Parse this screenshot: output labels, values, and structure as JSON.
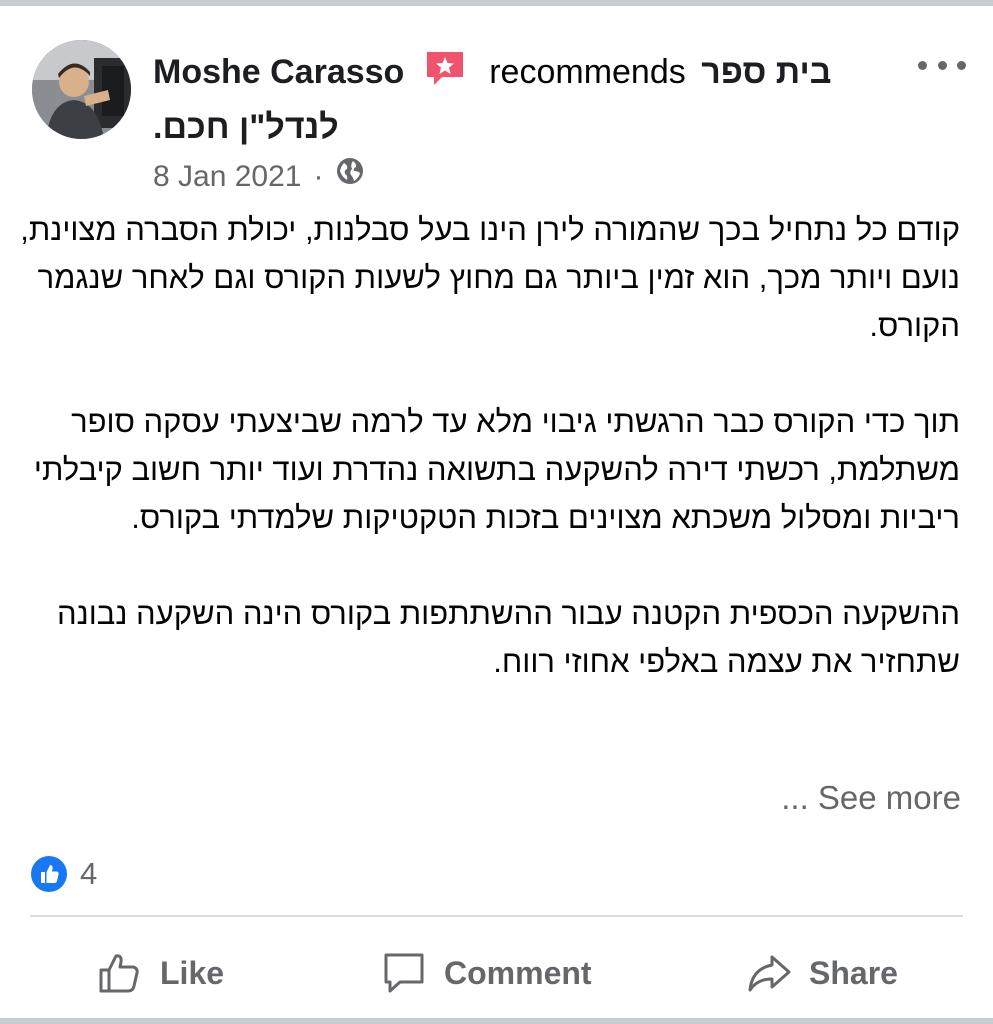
{
  "post": {
    "author": "Moshe Carasso",
    "verb": "recommends",
    "page_name_part1": "בית ספר",
    "page_name_part2": "לנדל\"ן חכם.",
    "date": "8 Jan 2021",
    "separator": "·",
    "privacy_icon": "globe-icon",
    "badge_icon": "recommendation-star-icon",
    "paragraphs": [
      "קודם כל נתחיל בכך שהמורה לירן הינו בעל סבלנות, יכולת הסברה מצוינת, נועם ויותר מכך, הוא זמין ביותר גם מחוץ לשעות הקורס וגם לאחר שנגמר הקורס.",
      "תוך כדי הקורס כבר הרגשתי גיבוי מלא עד לרמה שביצעתי עסקה סופר משתלמת, רכשתי דירה להשקעה בתשואה נהדרת ועוד יותר חשוב קיבלתי ריביות ומסלול משכתא מצוינים בזכות הטקטיקות שלמדתי בקורס.",
      "ההשקעה הכספית הקטנה עבור ההשתתפות בקורס הינה השקעה נבונה שתחזיר את עצמה באלפי אחוזי רווח."
    ],
    "see_more": "... See more"
  },
  "reactions": {
    "icon": "like-reaction-icon",
    "count": "4"
  },
  "actions": {
    "like": "Like",
    "comment": "Comment",
    "share": "Share"
  },
  "colors": {
    "text_primary": "#050505",
    "text_secondary": "#65676b",
    "like_blue": "#1877f2",
    "badge_pink": "#f0536c",
    "divider": "#dadde1"
  }
}
